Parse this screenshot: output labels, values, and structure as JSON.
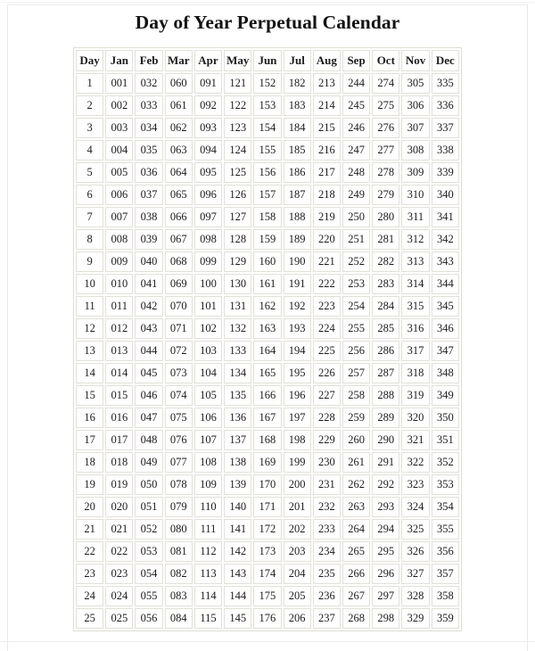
{
  "page": {
    "title": "Day of Year Perpetual Calendar"
  },
  "table": {
    "columns": [
      "Day",
      "Jan",
      "Feb",
      "Mar",
      "Apr",
      "May",
      "Jun",
      "Jul",
      "Aug",
      "Sep",
      "Oct",
      "Nov",
      "Dec"
    ],
    "rows": [
      [
        "1",
        "001",
        "032",
        "060",
        "091",
        "121",
        "152",
        "182",
        "213",
        "244",
        "274",
        "305",
        "335"
      ],
      [
        "2",
        "002",
        "033",
        "061",
        "092",
        "122",
        "153",
        "183",
        "214",
        "245",
        "275",
        "306",
        "336"
      ],
      [
        "3",
        "003",
        "034",
        "062",
        "093",
        "123",
        "154",
        "184",
        "215",
        "246",
        "276",
        "307",
        "337"
      ],
      [
        "4",
        "004",
        "035",
        "063",
        "094",
        "124",
        "155",
        "185",
        "216",
        "247",
        "277",
        "308",
        "338"
      ],
      [
        "5",
        "005",
        "036",
        "064",
        "095",
        "125",
        "156",
        "186",
        "217",
        "248",
        "278",
        "309",
        "339"
      ],
      [
        "6",
        "006",
        "037",
        "065",
        "096",
        "126",
        "157",
        "187",
        "218",
        "249",
        "279",
        "310",
        "340"
      ],
      [
        "7",
        "007",
        "038",
        "066",
        "097",
        "127",
        "158",
        "188",
        "219",
        "250",
        "280",
        "311",
        "341"
      ],
      [
        "8",
        "008",
        "039",
        "067",
        "098",
        "128",
        "159",
        "189",
        "220",
        "251",
        "281",
        "312",
        "342"
      ],
      [
        "9",
        "009",
        "040",
        "068",
        "099",
        "129",
        "160",
        "190",
        "221",
        "252",
        "282",
        "313",
        "343"
      ],
      [
        "10",
        "010",
        "041",
        "069",
        "100",
        "130",
        "161",
        "191",
        "222",
        "253",
        "283",
        "314",
        "344"
      ],
      [
        "11",
        "011",
        "042",
        "070",
        "101",
        "131",
        "162",
        "192",
        "223",
        "254",
        "284",
        "315",
        "345"
      ],
      [
        "12",
        "012",
        "043",
        "071",
        "102",
        "132",
        "163",
        "193",
        "224",
        "255",
        "285",
        "316",
        "346"
      ],
      [
        "13",
        "013",
        "044",
        "072",
        "103",
        "133",
        "164",
        "194",
        "225",
        "256",
        "286",
        "317",
        "347"
      ],
      [
        "14",
        "014",
        "045",
        "073",
        "104",
        "134",
        "165",
        "195",
        "226",
        "257",
        "287",
        "318",
        "348"
      ],
      [
        "15",
        "015",
        "046",
        "074",
        "105",
        "135",
        "166",
        "196",
        "227",
        "258",
        "288",
        "319",
        "349"
      ],
      [
        "16",
        "016",
        "047",
        "075",
        "106",
        "136",
        "167",
        "197",
        "228",
        "259",
        "289",
        "320",
        "350"
      ],
      [
        "17",
        "017",
        "048",
        "076",
        "107",
        "137",
        "168",
        "198",
        "229",
        "260",
        "290",
        "321",
        "351"
      ],
      [
        "18",
        "018",
        "049",
        "077",
        "108",
        "138",
        "169",
        "199",
        "230",
        "261",
        "291",
        "322",
        "352"
      ],
      [
        "19",
        "019",
        "050",
        "078",
        "109",
        "139",
        "170",
        "200",
        "231",
        "262",
        "292",
        "323",
        "353"
      ],
      [
        "20",
        "020",
        "051",
        "079",
        "110",
        "140",
        "171",
        "201",
        "232",
        "263",
        "293",
        "324",
        "354"
      ],
      [
        "21",
        "021",
        "052",
        "080",
        "111",
        "141",
        "172",
        "202",
        "233",
        "264",
        "294",
        "325",
        "355"
      ],
      [
        "22",
        "022",
        "053",
        "081",
        "112",
        "142",
        "173",
        "203",
        "234",
        "265",
        "295",
        "326",
        "356"
      ],
      [
        "23",
        "023",
        "054",
        "082",
        "113",
        "143",
        "174",
        "204",
        "235",
        "266",
        "296",
        "327",
        "357"
      ],
      [
        "24",
        "024",
        "055",
        "083",
        "114",
        "144",
        "175",
        "205",
        "236",
        "267",
        "297",
        "328",
        "358"
      ],
      [
        "25",
        "025",
        "056",
        "084",
        "115",
        "145",
        "176",
        "206",
        "237",
        "268",
        "298",
        "329",
        "359"
      ]
    ]
  }
}
